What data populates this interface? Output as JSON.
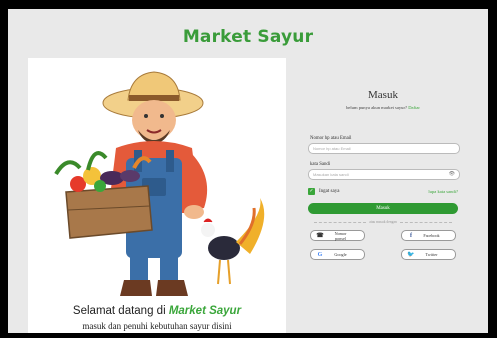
{
  "brand": "Market Sayur",
  "welcome": {
    "prefix": "Selamat datang di ",
    "highlight": "Market Sayur",
    "subtitle": "masuk dan penuhi kebutuhan sayur disini"
  },
  "login": {
    "title": "Masuk",
    "register_prompt": "belum punya akun market sayur?",
    "register_link": "Daftar",
    "identifier_label": "Nomor hp atau  Email",
    "identifier_placeholder": "Nomor hp atau Email",
    "password_label": "kata Sandi",
    "password_placeholder": "Masukan kata sandi",
    "remember_label": "Ingat saya",
    "remember_checked": true,
    "forgot_link": "lupa kata sandi?",
    "submit_label": "Masuk",
    "divider_text": "atau masuk dengan"
  },
  "social": [
    {
      "label": "Nomor ponsel",
      "icon": "phone-icon"
    },
    {
      "label": "Facebook",
      "icon": "facebook-icon"
    },
    {
      "label": "Google",
      "icon": "google-icon"
    },
    {
      "label": "Twitter",
      "icon": "twitter-icon"
    }
  ],
  "colors": {
    "brand": "#3a9c3a",
    "button": "#2f9a33",
    "background": "#e9e9e9"
  }
}
